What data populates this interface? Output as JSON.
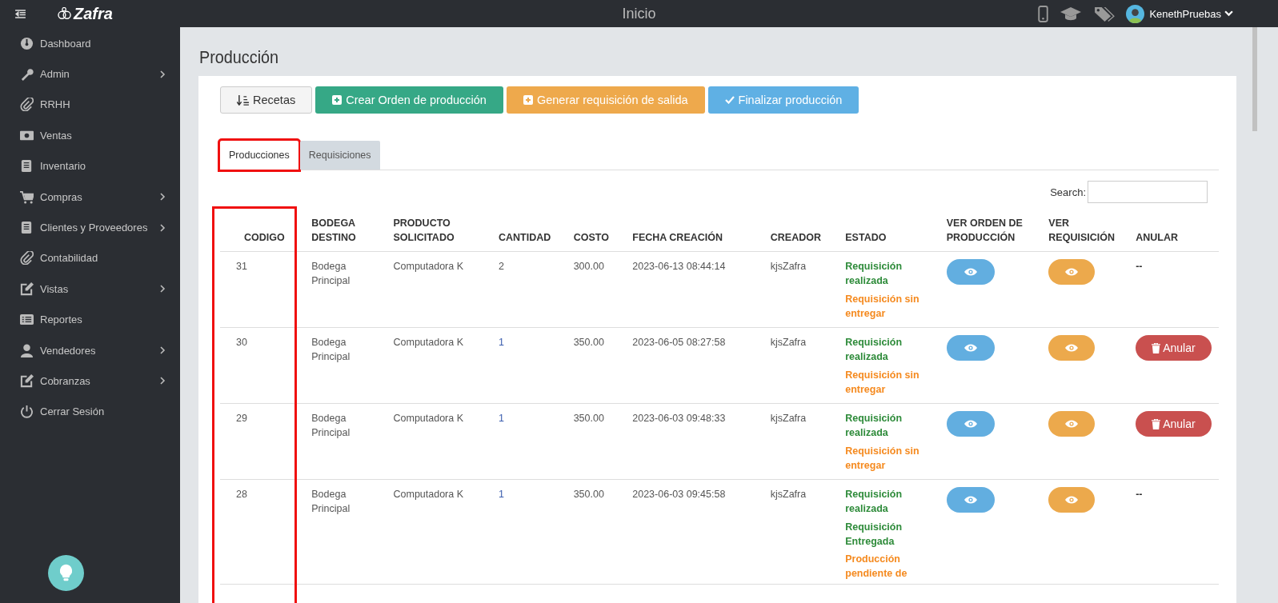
{
  "app": {
    "logo": "Zafra",
    "title": "Inicio",
    "user": "KenethPruebas"
  },
  "sidebar": {
    "items": [
      {
        "label": "Dashboard",
        "has_submenu": false
      },
      {
        "label": "Admin",
        "has_submenu": true
      },
      {
        "label": "RRHH",
        "has_submenu": false
      },
      {
        "label": "Ventas",
        "has_submenu": false
      },
      {
        "label": "Inventario",
        "has_submenu": false
      },
      {
        "label": "Compras",
        "has_submenu": true
      },
      {
        "label": "Clientes y Proveedores",
        "has_submenu": true
      },
      {
        "label": "Contabilidad",
        "has_submenu": false
      },
      {
        "label": "Vistas",
        "has_submenu": true
      },
      {
        "label": "Reportes",
        "has_submenu": false
      },
      {
        "label": "Vendedores",
        "has_submenu": true
      },
      {
        "label": "Cobranzas",
        "has_submenu": true
      },
      {
        "label": "Cerrar Sesión",
        "has_submenu": false
      }
    ]
  },
  "page": {
    "title": "Producción"
  },
  "toolbar": [
    {
      "label": "Recetas",
      "kind": "default"
    },
    {
      "label": "Crear Orden de producción",
      "kind": "success"
    },
    {
      "label": "Generar requisición de salida",
      "kind": "warning"
    },
    {
      "label": "Finalizar producción",
      "kind": "info"
    }
  ],
  "tabs": [
    {
      "label": "Producciones",
      "selected": true,
      "highlighted": true
    },
    {
      "label": "Requisiciones",
      "selected": false,
      "highlighted": false
    }
  ],
  "search": {
    "label": "Search:"
  },
  "table": {
    "columns": [
      {
        "label": "CODIGO",
        "highlighted": true
      },
      {
        "label": "BODEGA DESTINO",
        "highlighted": false
      },
      {
        "label": "PRODUCTO SOLICITADO",
        "highlighted": false
      },
      {
        "label": "CANTIDAD",
        "highlighted": false
      },
      {
        "label": "COSTO",
        "highlighted": false
      },
      {
        "label": "FECHA CREACIÓN",
        "highlighted": false
      },
      {
        "label": "CREADOR",
        "highlighted": false
      },
      {
        "label": "ESTADO",
        "highlighted": false
      },
      {
        "label": "VER ORDEN DE PRODUCCIÓN",
        "highlighted": false
      },
      {
        "label": "VER REQUISICIÓN",
        "highlighted": false
      },
      {
        "label": "ANULAR",
        "highlighted": false
      }
    ],
    "rows": [
      {
        "codigo": "31",
        "bodega": "Bodega Principal",
        "producto": "Computadora K",
        "cantidad": "2",
        "cantidad_link": false,
        "costo": "300.00",
        "fecha": "2023-06-13 08:44:14",
        "creador": "kjsZafra",
        "estado": [
          {
            "text": "Requisición realizada",
            "color": "#2e8b3a"
          },
          {
            "text": "Requisición sin entregar",
            "color": "#f58a1f"
          }
        ],
        "anular": {
          "kind": "text",
          "text": "--"
        }
      },
      {
        "codigo": "30",
        "bodega": "Bodega Principal",
        "producto": "Computadora K",
        "cantidad": "1",
        "cantidad_link": true,
        "costo": "350.00",
        "fecha": "2023-06-05 08:27:58",
        "creador": "kjsZafra",
        "estado": [
          {
            "text": "Requisición realizada",
            "color": "#2e8b3a"
          },
          {
            "text": "Requisición sin entregar",
            "color": "#f58a1f"
          }
        ],
        "anular": {
          "kind": "button",
          "text": "Anular"
        }
      },
      {
        "codigo": "29",
        "bodega": "Bodega Principal",
        "producto": "Computadora K",
        "cantidad": "1",
        "cantidad_link": true,
        "costo": "350.00",
        "fecha": "2023-06-03 09:48:33",
        "creador": "kjsZafra",
        "estado": [
          {
            "text": "Requisición realizada",
            "color": "#2e8b3a"
          },
          {
            "text": "Requisición sin entregar",
            "color": "#f58a1f"
          }
        ],
        "anular": {
          "kind": "button",
          "text": "Anular"
        }
      },
      {
        "codigo": "28",
        "bodega": "Bodega Principal",
        "producto": "Computadora K",
        "cantidad": "1",
        "cantidad_link": true,
        "costo": "350.00",
        "fecha": "2023-06-03 09:45:58",
        "creador": "kjsZafra",
        "estado": [
          {
            "text": "Requisición realizada",
            "color": "#2e8b3a"
          },
          {
            "text": "Requisición Entregada",
            "color": "#2e8b3a"
          },
          {
            "text": "Producción pendiente de",
            "color": "#f58a1f"
          }
        ],
        "anular": {
          "kind": "text",
          "text": "--"
        }
      }
    ]
  }
}
